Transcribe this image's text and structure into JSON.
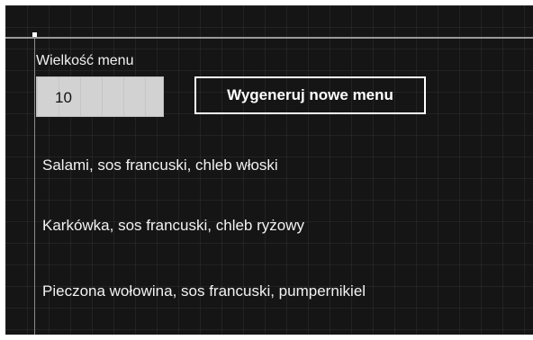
{
  "form": {
    "size_label": "Wielkość menu",
    "size_value": "10",
    "generate_button_label": "Wygeneruj nowe menu"
  },
  "menu": {
    "items": [
      "Salami, sos francuski, chleb włoski",
      "Karkówka, sos francuski, chleb ryżowy",
      "Pieczona wołowina, sos francuski, pumpernikiel"
    ]
  },
  "colors": {
    "background": "#151515",
    "text": "#f2f2f2",
    "input_background": "#d2d2d2",
    "button_border": "#ffffff"
  }
}
